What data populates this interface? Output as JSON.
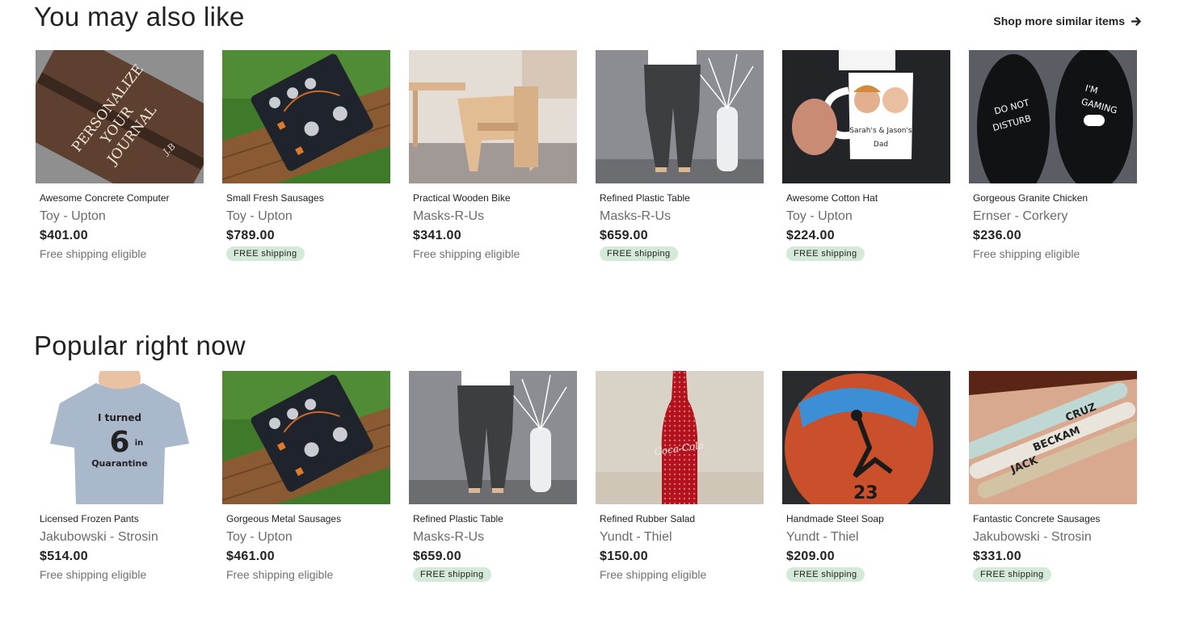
{
  "sections": [
    {
      "title": "You may also like",
      "shop_more": "Shop more similar items",
      "products": [
        {
          "name": "Awesome Concrete Computer",
          "shop": "Toy - Upton",
          "price": "$401.00",
          "shipping": "Free shipping eligible",
          "shipping_style": "text",
          "image": "leather-journal"
        },
        {
          "name": "Small Fresh Sausages",
          "shop": "Toy - Upton",
          "price": "$789.00",
          "shipping": "FREE shipping",
          "shipping_style": "badge",
          "image": "electronics-board"
        },
        {
          "name": "Practical Wooden Bike",
          "shop": "Masks-R-Us",
          "price": "$341.00",
          "shipping": "Free shipping eligible",
          "shipping_style": "text",
          "image": "wooden-chair"
        },
        {
          "name": "Refined Plastic Table",
          "shop": "Masks-R-Us",
          "price": "$659.00",
          "shipping": "FREE shipping",
          "shipping_style": "badge",
          "image": "pants-vase"
        },
        {
          "name": "Awesome Cotton Hat",
          "shop": "Toy - Upton",
          "price": "$224.00",
          "shipping": "FREE shipping",
          "shipping_style": "badge",
          "image": "photo-mug"
        },
        {
          "name": "Gorgeous Granite Chicken",
          "shop": "Ernser - Corkery",
          "price": "$236.00",
          "shipping": "Free shipping eligible",
          "shipping_style": "text",
          "image": "gaming-socks"
        }
      ]
    },
    {
      "title": "Popular right now",
      "products": [
        {
          "name": "Licensed Frozen Pants",
          "shop": "Jakubowski - Strosin",
          "price": "$514.00",
          "shipping": "Free shipping eligible",
          "shipping_style": "text",
          "image": "kids-tshirt"
        },
        {
          "name": "Gorgeous Metal Sausages",
          "shop": "Toy - Upton",
          "price": "$461.00",
          "shipping": "Free shipping eligible",
          "shipping_style": "text",
          "image": "electronics-board"
        },
        {
          "name": "Refined Plastic Table",
          "shop": "Masks-R-Us",
          "price": "$659.00",
          "shipping": "FREE shipping",
          "shipping_style": "badge",
          "image": "pants-vase"
        },
        {
          "name": "Refined Rubber Salad",
          "shop": "Yundt - Thiel",
          "price": "$150.00",
          "shipping": "Free shipping eligible",
          "shipping_style": "text",
          "image": "rhinestone-bottle"
        },
        {
          "name": "Handmade Steel Soap",
          "shop": "Yundt - Thiel",
          "price": "$209.00",
          "shipping": "FREE shipping",
          "shipping_style": "badge",
          "image": "painted-basketball"
        },
        {
          "name": "Fantastic Concrete Sausages",
          "shop": "Jakubowski - Strosin",
          "price": "$331.00",
          "shipping": "FREE shipping",
          "shipping_style": "badge",
          "image": "name-bracelets"
        }
      ]
    }
  ],
  "image_text": {
    "leather-journal": [
      "PERSONALIZE",
      "YOUR",
      "JOURNAL",
      "J.B"
    ],
    "photo-mug": [
      "Sarah's & Jason's",
      "Dad"
    ],
    "gaming-socks": [
      "DO NOT",
      "DISTURB",
      "I'M",
      "GAMING"
    ],
    "kids-tshirt": [
      "I turned",
      "6",
      "in",
      "Quarantine"
    ],
    "rhinestone-bottle": [
      "Coca-Cola"
    ],
    "painted-basketball": [
      "23"
    ],
    "name-bracelets": [
      "CRUZ",
      "BECKAM",
      "JACK"
    ]
  },
  "colors": {
    "badge_bg": "#d4e9d7",
    "muted_text": "#6b6b6b"
  },
  "icons": {
    "shop_more": "arrow-right-icon"
  }
}
